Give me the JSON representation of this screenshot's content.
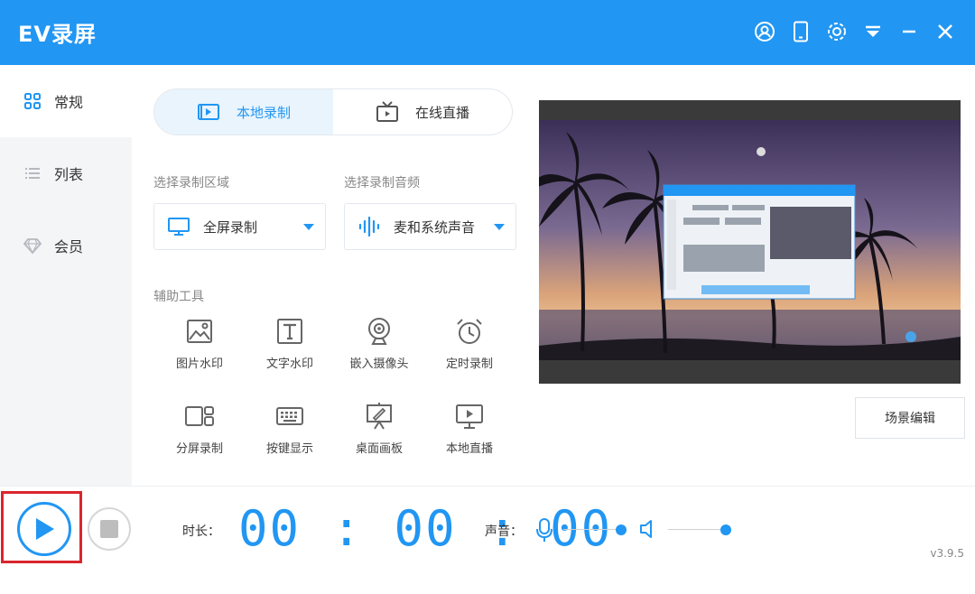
{
  "app": {
    "title": "EV录屏",
    "version": "v3.9.5"
  },
  "titlebar_icons": [
    "user-icon",
    "phone-icon",
    "settings-icon",
    "dropdown-menu-icon",
    "minimize-icon",
    "close-icon"
  ],
  "sidebar": {
    "items": [
      {
        "label": "常规",
        "icon": "grid-icon",
        "active": true
      },
      {
        "label": "列表",
        "icon": "list-icon",
        "active": false
      },
      {
        "label": "会员",
        "icon": "diamond-icon",
        "active": false
      }
    ]
  },
  "tabs": [
    {
      "label": "本地录制",
      "icon": "local-record-icon",
      "active": true
    },
    {
      "label": "在线直播",
      "icon": "tv-icon",
      "active": false
    }
  ],
  "area": {
    "label": "选择录制区域",
    "value": "全屏录制",
    "icon": "monitor-icon"
  },
  "audio": {
    "label": "选择录制音频",
    "value": "麦和系统声音",
    "icon": "soundwave-icon"
  },
  "tools": {
    "label": "辅助工具",
    "items": [
      {
        "label": "图片水印",
        "icon": "image-watermark-icon"
      },
      {
        "label": "文字水印",
        "icon": "text-watermark-icon"
      },
      {
        "label": "嵌入摄像头",
        "icon": "webcam-icon"
      },
      {
        "label": "定时录制",
        "icon": "alarm-clock-icon"
      },
      {
        "label": "分屏录制",
        "icon": "split-screen-icon"
      },
      {
        "label": "按键显示",
        "icon": "keyboard-icon"
      },
      {
        "label": "桌面画板",
        "icon": "drawing-board-icon"
      },
      {
        "label": "本地直播",
        "icon": "local-live-icon"
      }
    ]
  },
  "scene_edit": "场景编辑",
  "controls": {
    "duration_label": "时长：",
    "timer": "00 : 00 : 00",
    "sound_label": "声音：",
    "mic_level": 1.0,
    "speaker_level": 1.0
  },
  "colors": {
    "accent": "#2196F3",
    "highlight": "#d9262c",
    "sidebar_bg": "#f4f5f7"
  }
}
